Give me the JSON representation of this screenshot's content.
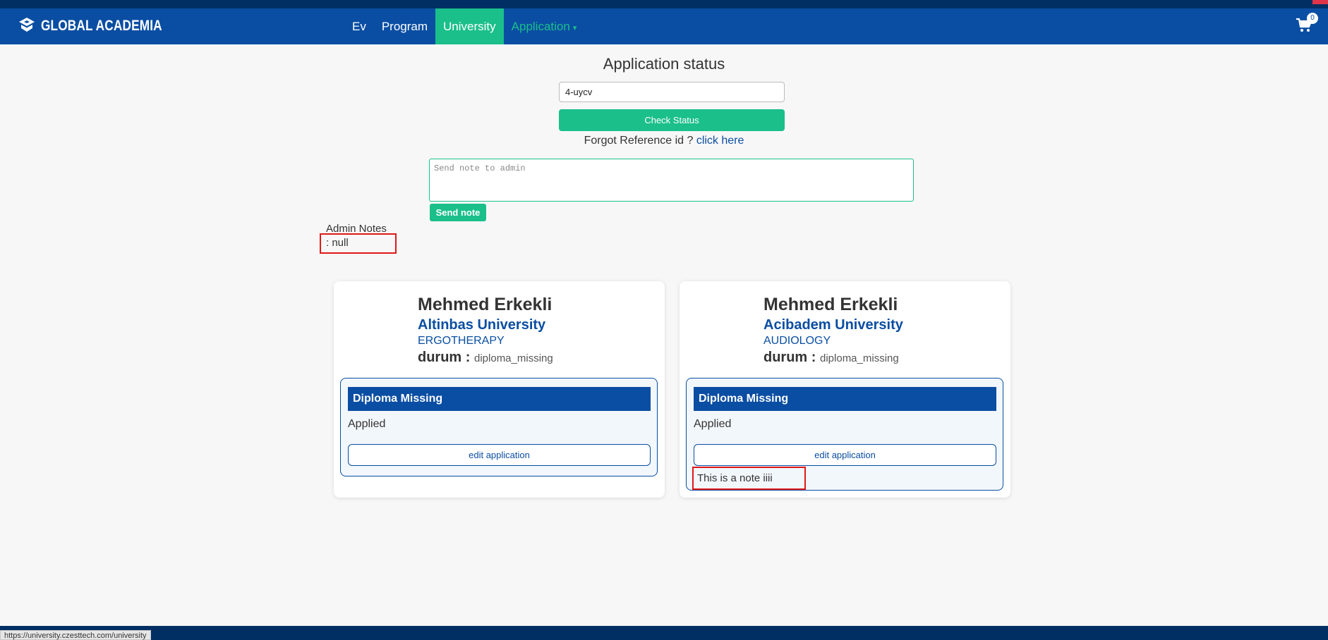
{
  "brand": {
    "name": "GLOBAL ACADEMIA",
    "logo_icon": "shield-logo"
  },
  "nav": {
    "items": [
      {
        "label": "Ev"
      },
      {
        "label": "Program"
      },
      {
        "label": "University",
        "active": true
      },
      {
        "label": "Application",
        "dropdown": true
      }
    ],
    "cart_count": "0"
  },
  "status": {
    "title": "Application status",
    "reference_value": "4-uycv",
    "check_label": "Check Status",
    "forgot_text": "Forgot Reference id ?",
    "forgot_link": "click here"
  },
  "note": {
    "placeholder": "Send note to admin",
    "send_label": "Send note"
  },
  "admin_notes": {
    "label": "Admin Notes",
    "value": ": null"
  },
  "applications": [
    {
      "student": "Mehmed Erkekli",
      "university": "Altinbas University",
      "program": "ERGOTHERAPY",
      "durum_label": "durum :",
      "durum_value": "diploma_missing",
      "status_header": "Diploma Missing",
      "stage": "Applied",
      "edit_label": "edit application",
      "note": ""
    },
    {
      "student": "Mehmed Erkekli",
      "university": "Acibadem University",
      "program": "AUDIOLOGY",
      "durum_label": "durum :",
      "durum_value": "diploma_missing",
      "status_header": "Diploma Missing",
      "stage": "Applied",
      "edit_label": "edit application",
      "note": "This is a note iiii"
    }
  ],
  "statusbar": {
    "url": "https://university.czesttech.com/university"
  },
  "colors": {
    "primary": "#0a4ea3",
    "accent": "#1bbf8a",
    "highlight": "#e01818",
    "dark": "#012f63"
  }
}
